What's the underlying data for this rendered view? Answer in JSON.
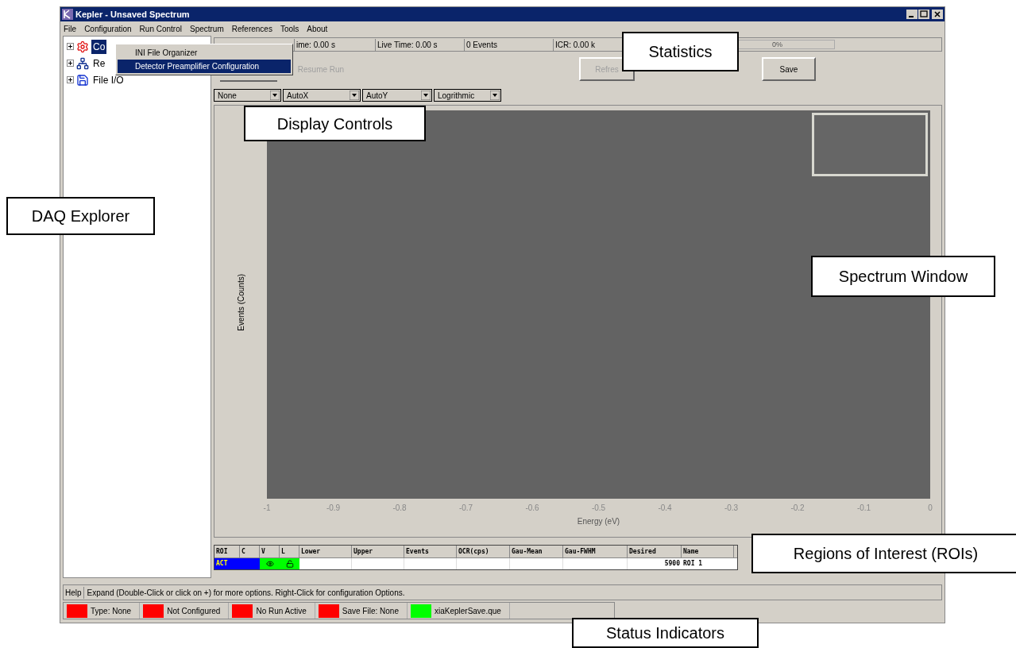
{
  "window": {
    "title": "Kepler - Unsaved Spectrum"
  },
  "menu": [
    "File",
    "Configuration",
    "Run Control",
    "Spectrum",
    "References",
    "Tools",
    "About"
  ],
  "tree": [
    {
      "label": "Co",
      "kind": "config",
      "expanded": false,
      "selected": true
    },
    {
      "label": "Re",
      "kind": "network",
      "expanded": false,
      "selected": false
    },
    {
      "label": "File I/O",
      "kind": "file",
      "expanded": false,
      "selected": false
    }
  ],
  "context_menu": [
    {
      "label": "INI File Organizer",
      "selected": false
    },
    {
      "label": "Detector Preamplifier Configuration",
      "selected": true
    }
  ],
  "statistics": [
    "ime: 0.00 s",
    "Live Time: 0.00 s",
    "0 Events",
    "ICR: 0.00 k"
  ],
  "progress": {
    "label": "0%",
    "level": 0
  },
  "buttons": [
    {
      "label": "Resume Run",
      "disabled": true
    },
    {
      "label": "Refres",
      "disabled": true
    },
    {
      "label": "Save",
      "disabled": false
    }
  ],
  "display_controls": [
    "None",
    "AutoX",
    "AutoY",
    "Logrithmic"
  ],
  "plot": {
    "ylabel": "Events (Counts)",
    "xlabel": "Energy (eV)",
    "xticks": [
      "-1",
      "-0.9",
      "-0.8",
      "-0.7",
      "-0.6",
      "-0.5",
      "-0.4",
      "-0.3",
      "-0.2",
      "-0.1",
      "0"
    ]
  },
  "roi_table": {
    "columns": [
      "ROI",
      "C",
      "V",
      "L",
      "Lower",
      "Upper",
      "Events",
      "OCR(cps)",
      "Gau-Mean",
      "Gau-FWHM",
      "Desired",
      "Name"
    ],
    "rows": [
      {
        "roi": "ACT",
        "color": "#0000ff",
        "visible": true,
        "locked": false,
        "desired": "5900",
        "name": "ROI 1"
      }
    ]
  },
  "help": {
    "label": "Help",
    "text": "Expand (Double-Click or click on +) for more options.  Right-Click for configuration Options."
  },
  "status_indicators": [
    {
      "label": "Type: None",
      "color": "#ff0000"
    },
    {
      "label": "Not Configured",
      "color": "#ff0000"
    },
    {
      "label": "No Run Active",
      "color": "#ff0000"
    },
    {
      "label": "Save File: None",
      "color": "#ff0000"
    },
    {
      "label": "xiaKeplerSave.que",
      "color": "#00ff00"
    }
  ],
  "callouts": [
    "Statistics",
    "Display Controls",
    "DAQ Explorer",
    "Spectrum Window",
    "Regions of Interest (ROIs)",
    "Status Indicators"
  ]
}
